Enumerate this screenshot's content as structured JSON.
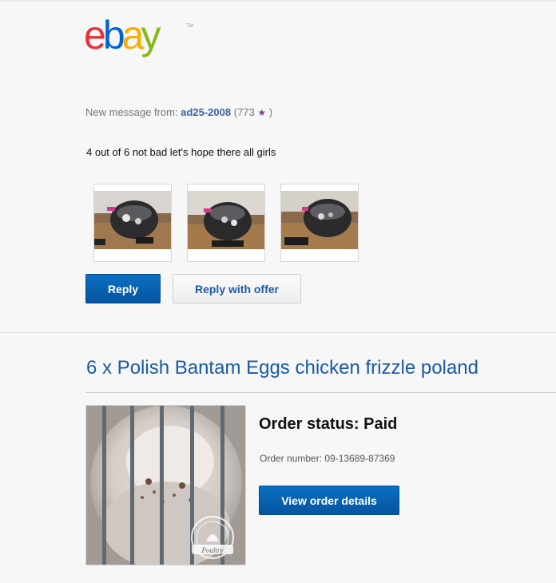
{
  "brand": {
    "logo_letters": [
      {
        "char": "e",
        "color": "#e53238"
      },
      {
        "char": "b",
        "color": "#0064d2"
      },
      {
        "char": "a",
        "color": "#f5af02"
      },
      {
        "char": "y",
        "color": "#86b817"
      }
    ],
    "trademark": "TM"
  },
  "message": {
    "from_label": "New message from:",
    "username": "ad25-2008",
    "feedback_open": "(773",
    "star": "★",
    "feedback_close": ")",
    "body": "4 out of 6 not bad let's hope there all girls"
  },
  "actions": {
    "reply_label": "Reply",
    "reply_offer_label": "Reply with offer"
  },
  "item": {
    "title": "6 x Polish Bantam Eggs chicken frizzle poland",
    "status": "Order status: Paid",
    "order_number": "Order number: 09-13689-87369",
    "view_order_label": "View order details",
    "watermark_text": "Poultry"
  },
  "colors": {
    "link_blue": "#3a62a0",
    "button_blue": "#0654a0",
    "title_blue": "#1a5aa6"
  }
}
